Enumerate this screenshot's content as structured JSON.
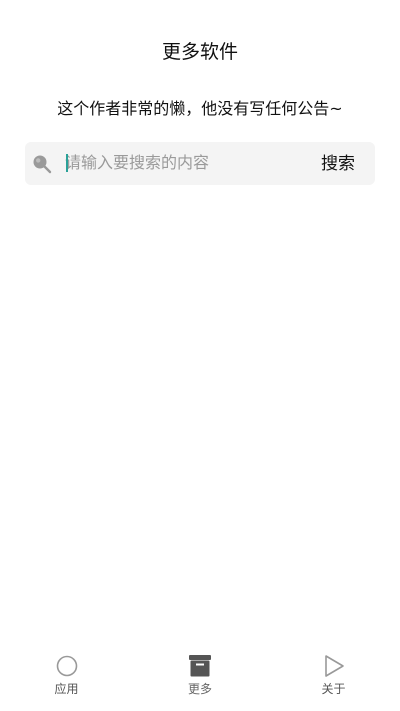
{
  "header": {
    "title": "更多软件"
  },
  "notice": {
    "text": "这个作者非常的懒，他没有写任何公告~"
  },
  "search": {
    "placeholder": "请输入要搜索的内容",
    "value": "",
    "button_label": "搜索",
    "icon": "search-icon"
  },
  "bottom_nav": {
    "items": [
      {
        "label": "应用",
        "icon": "circle-icon",
        "active": false
      },
      {
        "label": "更多",
        "icon": "archive-box-icon",
        "active": true
      },
      {
        "label": "关于",
        "icon": "play-triangle-icon",
        "active": false
      }
    ]
  },
  "colors": {
    "search_bg": "#f4f4f4",
    "caret": "#2aa198",
    "icon_active": "#555555",
    "icon_inactive": "#999999"
  }
}
